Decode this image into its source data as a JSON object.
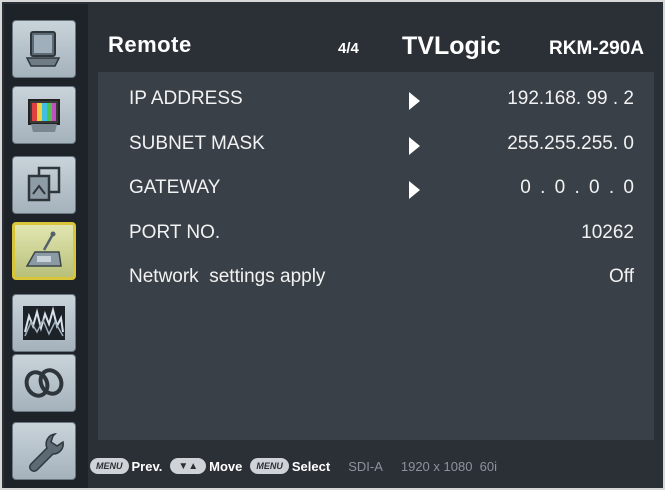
{
  "header": {
    "title": "Remote",
    "page": "4/4",
    "brand": "TVLogic",
    "model": "RKM-290A"
  },
  "rows": [
    {
      "label": "IP ADDRESS",
      "value": "192.168. 99 . 2",
      "has_arrow": true
    },
    {
      "label": "SUBNET MASK",
      "value": "255.255.255. 0",
      "has_arrow": true
    },
    {
      "label": "GATEWAY",
      "value": "0 . 0 . 0 . 0",
      "has_arrow": true
    },
    {
      "label": "PORT NO.",
      "value": "10262",
      "has_arrow": false
    },
    {
      "label": "Network  settings apply",
      "value": "Off",
      "has_arrow": false
    }
  ],
  "sidebar": {
    "items": [
      {
        "icon": "monitor-icon",
        "active": false
      },
      {
        "icon": "color-display-icon",
        "active": false
      },
      {
        "icon": "screen-stack-icon",
        "active": false
      },
      {
        "icon": "remote-antenna-icon",
        "active": true
      },
      {
        "icon": "waveform-icon",
        "active": false
      },
      {
        "icon": "rings-icon",
        "active": false
      },
      {
        "icon": "wrench-icon",
        "active": false
      }
    ]
  },
  "footer": {
    "menu_key": "MENU",
    "prev_label": "Prev.",
    "nav_key": "▼▲",
    "move_label": "Move",
    "select_key": "MENU",
    "select_label": "Select",
    "input_source": "SDI-A",
    "resolution": "1920 x 1080  60i"
  },
  "colors": {
    "background": "#2b3037",
    "panel": "#3a4048",
    "active_border": "#d8c53a",
    "text": "#ffffff",
    "status_text": "#8d939a"
  }
}
